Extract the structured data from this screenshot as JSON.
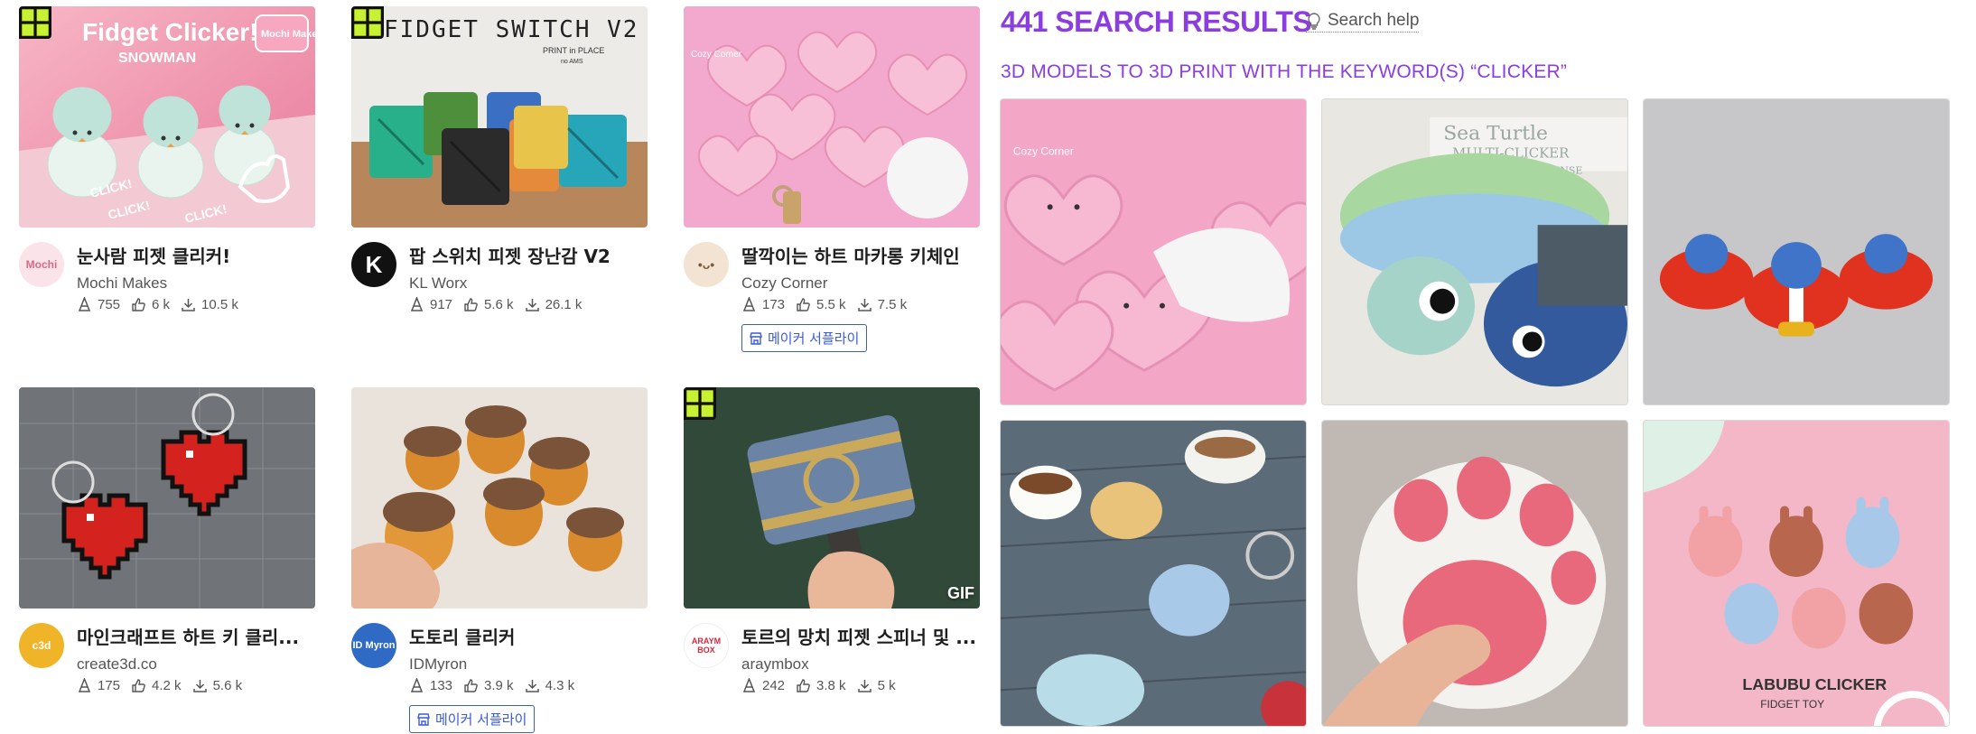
{
  "left_cards": [
    {
      "title": "눈사람 피젯 클리커!",
      "author": "Mochi Makes",
      "stats": {
        "downloads_views": "755",
        "likes": "6 k",
        "downloads": "10.5 k"
      },
      "image_text": {
        "headline": "Fidget Clicker!",
        "sub": "SNOWMAN",
        "logo": "Mochi Makes",
        "click1": "CLICK!",
        "click2": "CLICK!",
        "click3": "CLICK!"
      },
      "avatar_text": "Mochi"
    },
    {
      "title": "팝 스위치 피젯 장난감 V2",
      "author": "KL Worx",
      "stats": {
        "downloads_views": "917",
        "likes": "5.6 k",
        "downloads": "26.1 k"
      },
      "image_text": {
        "headline": "FIDGET SWITCH V2",
        "sub": "PRINT in PLACE",
        "sub2": "no AMS"
      },
      "avatar_text": "K"
    },
    {
      "title": "딸깍이는 하트 마카롱 키체인",
      "author": "Cozy Corner",
      "stats": {
        "downloads_views": "173",
        "likes": "5.5 k",
        "downloads": "7.5 k"
      },
      "maker_tag": "메이커 서플라이",
      "image_text": {
        "logo": "Cozy Corner"
      },
      "avatar_text": "•ᴗ•"
    },
    {
      "title": "마인크래프트 하트 키 클리...",
      "author": "create3d.co",
      "stats": {
        "downloads_views": "175",
        "likes": "4.2 k",
        "downloads": "5.6 k"
      },
      "avatar_text": "c3d"
    },
    {
      "title": "도토리 클리커",
      "author": "IDMyron",
      "stats": {
        "downloads_views": "133",
        "likes": "3.9 k",
        "downloads": "4.3 k"
      },
      "maker_tag": "메이커 서플라이",
      "avatar_text": "ID Myron"
    },
    {
      "title": "토르의 망치 피젯 스피너 및 ...",
      "author": "araymbox",
      "stats": {
        "downloads_views": "242",
        "likes": "3.8 k",
        "downloads": "5 k"
      },
      "badge": "GIF",
      "avatar_text": "ARAYM BOX"
    }
  ],
  "right": {
    "results_title": "441 SEARCH RESULTS",
    "search_help": "Search help",
    "keyword_line": "3D MODELS TO 3D PRINT WITH THE KEYWORD(S) “CLICKER”",
    "thumb_texts": {
      "turtle_title": "Sea Turtle",
      "turtle_sub": "MULTI-CLICKER",
      "turtle_license": "PERSONAL USE LICENSE",
      "labubu_title": "LABUBU CLICKER",
      "labubu_sub": "FIDGET TOY",
      "cozy_logo": "Cozy Corner"
    }
  },
  "colors": {
    "accent_purple": "#8a3ee0",
    "maker_blue": "#3a5bd9",
    "stat_gray": "#555555"
  },
  "icons": [
    "premium-badge-icon",
    "downloads-cone-icon",
    "thumbs-up-icon",
    "download-icon",
    "lightbulb-icon",
    "shop-icon"
  ]
}
